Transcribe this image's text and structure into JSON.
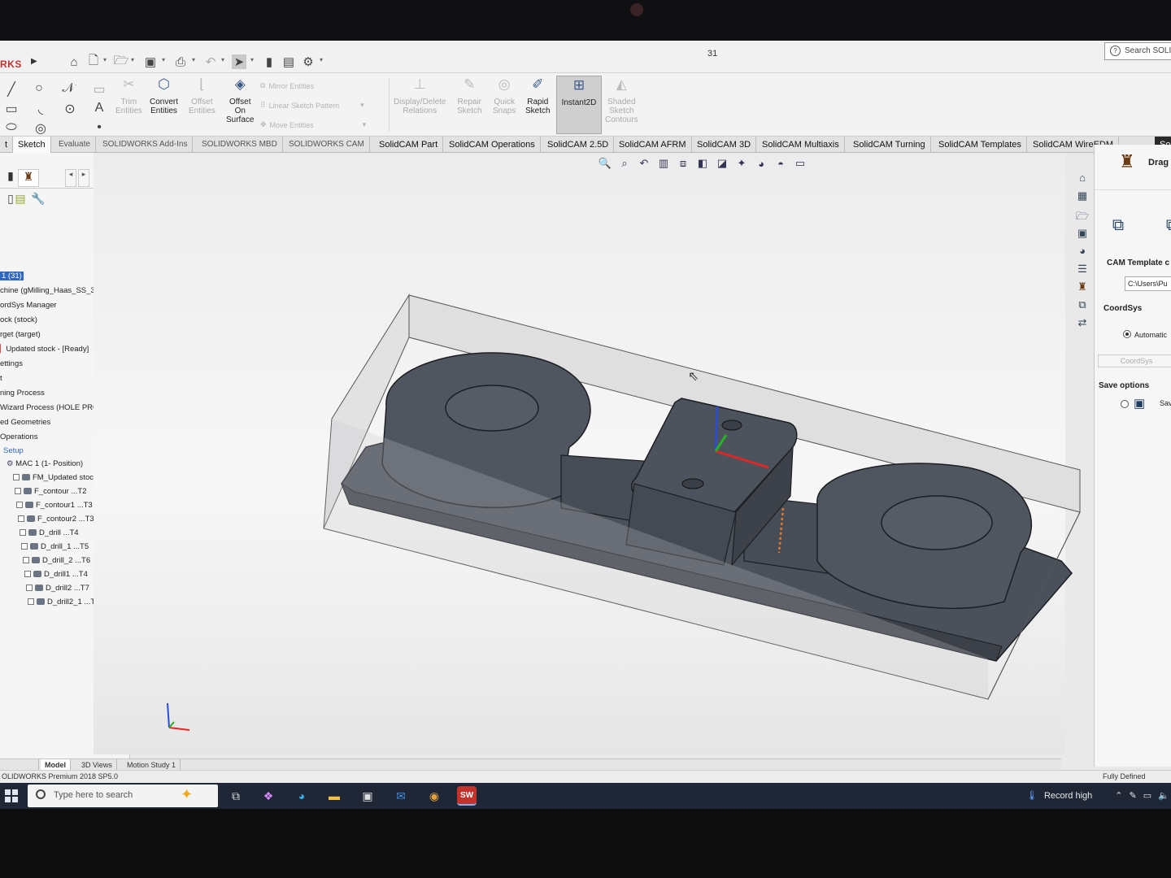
{
  "app": {
    "brand": "RKS",
    "document_title": "31",
    "search_label": "Search SOLI"
  },
  "ribbon": {
    "trim": "Trim\nEntities",
    "convert": "Convert\nEntities",
    "offset": "Offset\nEntities",
    "offset_surface": "Offset\nOn\nSurface",
    "mirror": "Mirror Entities",
    "linear_pattern": "Linear Sketch Pattern",
    "move": "Move Entities",
    "display_delete": "Display/Delete\nRelations",
    "repair": "Repair\nSketch",
    "quick_snaps": "Quick\nSnaps",
    "rapid_sketch": "Rapid\nSketch",
    "instant2d": "Instant2D",
    "shaded": "Shaded\nSketch\nContours"
  },
  "tabs": [
    {
      "label": "t"
    },
    {
      "label": "Sketch"
    },
    {
      "label": "Evaluate"
    },
    {
      "label": "SOLIDWORKS Add-Ins"
    },
    {
      "label": "SOLIDWORKS MBD"
    },
    {
      "label": "SOLIDWORKS CAM"
    },
    {
      "label": "SolidCAM Part"
    },
    {
      "label": "SolidCAM Operations"
    },
    {
      "label": "SolidCAM 2.5D"
    },
    {
      "label": "SolidCAM AFRM"
    },
    {
      "label": "SolidCAM 3D"
    },
    {
      "label": "SolidCAM Multiaxis"
    },
    {
      "label": "SolidCAM Turning"
    },
    {
      "label": "SolidCAM Templates"
    },
    {
      "label": "SolidCAM WireEDM"
    },
    {
      "label": "So"
    }
  ],
  "tree": {
    "root": "1 (31)",
    "machine": "chine (gMilling_Haas_SS_3x)",
    "coordsys": "ordSys Manager",
    "stock": "ock (stock)",
    "target": "rget (target)",
    "updated_stock": "Updated stock - [Ready]",
    "settings": "ettings",
    "t": "t",
    "process": "ning Process",
    "wizard": "Wizard Process (HOLE PROCES",
    "geometries": "ed Geometries",
    "operations": "Operations",
    "setup": "Setup",
    "mac": "MAC 1 (1- Position)",
    "ops": [
      "FM_Updated stoc",
      "F_contour ...T2",
      "F_contour1 ...T3",
      "F_contour2 ...T3",
      "D_drill ...T4",
      "D_drill_1 ...T5",
      "D_drill_2 ...T6",
      "D_drill1 ...T4",
      "D_drill2 ...T7",
      "D_drill2_1 ...T8"
    ]
  },
  "panel": {
    "title": "Drag",
    "cam_template": "CAM Template c",
    "template_path": "C:\\Users\\Pu",
    "coordsys_label": "CoordSys",
    "automatic": "Automatic",
    "coordsys_btn": "CoordSys",
    "save_options": "Save options",
    "save_text": "Sav"
  },
  "model_tabs": [
    {
      "label": "Model"
    },
    {
      "label": "3D Views"
    },
    {
      "label": "Motion Study 1"
    }
  ],
  "status": {
    "left": "OLIDWORKS Premium 2018 SP5.0",
    "right": "Fully Defined"
  },
  "taskbar": {
    "search_placeholder": "Type here to search",
    "record": "Record high"
  },
  "colors": {
    "brand_red": "#c4322c",
    "part_body": "#4b515b",
    "selection_blue": "#2f67c1"
  }
}
